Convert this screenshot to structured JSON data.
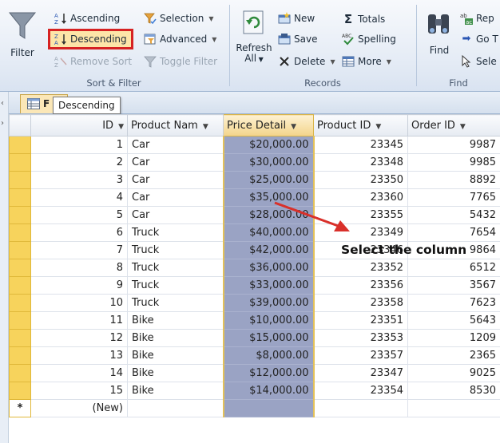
{
  "ribbon": {
    "sort_filter": {
      "filter_label": "Filter",
      "ascending": "Ascending",
      "descending": "Descending",
      "remove_sort": "Remove Sort",
      "selection": "Selection",
      "advanced": "Advanced",
      "toggle_filter": "Toggle Filter",
      "group_label": "Sort & Filter"
    },
    "records": {
      "refresh_line1": "Refresh",
      "refresh_line2": "All",
      "new": "New",
      "save": "Save",
      "delete": "Delete",
      "totals": "Totals",
      "spelling": "Spelling",
      "more": "More",
      "group_label": "Records"
    },
    "find": {
      "find_label": "Find",
      "replace": "Rep",
      "goto": "Go T",
      "select": "Sele",
      "group_label": "Find"
    }
  },
  "tab": {
    "label": "F"
  },
  "tooltip": "Descending",
  "table": {
    "columns": [
      "ID",
      "Product Nam",
      "Price Detail",
      "Product ID",
      "Order ID"
    ],
    "rows": [
      [
        "1",
        "Car",
        "$20,000.00",
        "23345",
        "9987"
      ],
      [
        "2",
        "Car",
        "$30,000.00",
        "23348",
        "9985"
      ],
      [
        "3",
        "Car",
        "$25,000.00",
        "23350",
        "8892"
      ],
      [
        "4",
        "Car",
        "$35,000.00",
        "23360",
        "7765"
      ],
      [
        "5",
        "Car",
        "$28,000.00",
        "23355",
        "5432"
      ],
      [
        "6",
        "Truck",
        "$40,000.00",
        "23349",
        "7654"
      ],
      [
        "7",
        "Truck",
        "$42,000.00",
        "23346",
        "9864"
      ],
      [
        "8",
        "Truck",
        "$36,000.00",
        "23352",
        "6512"
      ],
      [
        "9",
        "Truck",
        "$33,000.00",
        "23356",
        "3567"
      ],
      [
        "10",
        "Truck",
        "$39,000.00",
        "23358",
        "7623"
      ],
      [
        "11",
        "Bike",
        "$10,000.00",
        "23351",
        "5643"
      ],
      [
        "12",
        "Bike",
        "$15,000.00",
        "23353",
        "1209"
      ],
      [
        "13",
        "Bike",
        "$8,000.00",
        "23357",
        "2365"
      ],
      [
        "14",
        "Bike",
        "$12,000.00",
        "23347",
        "9025"
      ],
      [
        "15",
        "Bike",
        "$14,000.00",
        "23354",
        "8530"
      ]
    ],
    "new_row_marker": "*",
    "new_row_label": "(New)"
  },
  "annotation": "Select the column",
  "colors": {
    "highlight_border": "#d62222",
    "selected_column": "#9aa3c4",
    "row_selector": "#f7d35c",
    "arrow": "#d9302a"
  },
  "icons": [
    "filter-funnel-icon",
    "sort-ascending-icon",
    "sort-descending-icon",
    "remove-sort-icon",
    "selection-icon",
    "advanced-icon",
    "toggle-filter-icon",
    "refresh-icon",
    "new-record-icon",
    "save-icon",
    "delete-icon",
    "totals-icon",
    "spelling-icon",
    "more-icon",
    "binoculars-icon",
    "replace-icon",
    "goto-icon",
    "select-icon",
    "table-icon"
  ]
}
